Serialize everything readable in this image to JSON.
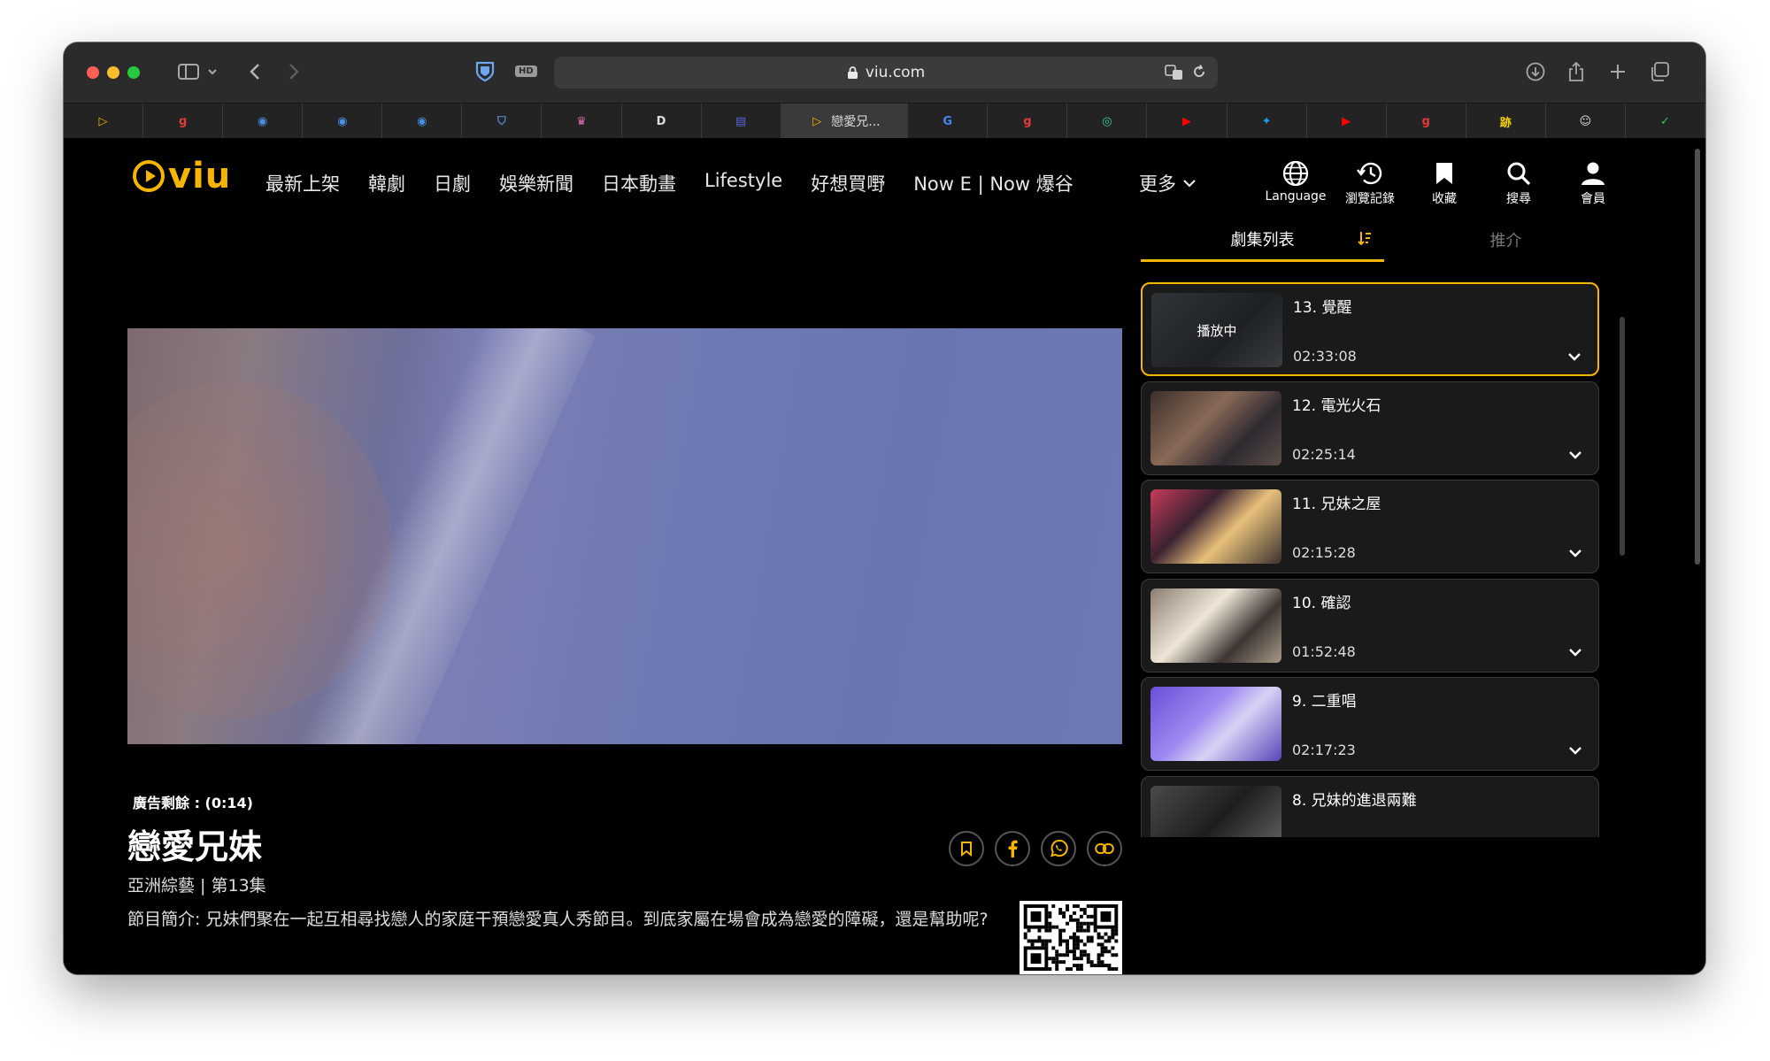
{
  "browser": {
    "url": "viu.com",
    "badge": "HD",
    "active_tab_title": "戀愛兄...",
    "tabs": [
      {
        "icon": "viu-play-icon",
        "color": "#f6b500",
        "glyph": "▷"
      },
      {
        "icon": "g-icon",
        "color": "#e23b3b",
        "glyph": "g"
      },
      {
        "icon": "globe-icon",
        "color": "#4a90e2",
        "glyph": "◉"
      },
      {
        "icon": "globe-icon",
        "color": "#4a90e2",
        "glyph": "◉"
      },
      {
        "icon": "globe-icon",
        "color": "#4a90e2",
        "glyph": "◉"
      },
      {
        "icon": "bitwarden-icon",
        "color": "#5c8fd6",
        "glyph": "⛉"
      },
      {
        "icon": "trophy-icon",
        "color": "#e06bb0",
        "glyph": "♛"
      },
      {
        "icon": "d-icon",
        "color": "#dddddd",
        "glyph": "D"
      },
      {
        "icon": "stack-icon",
        "color": "#5a63d8",
        "glyph": "▤"
      },
      {
        "icon": "viu-play-icon",
        "color": "#f6b500",
        "glyph": "▷"
      },
      {
        "icon": "google-icon",
        "color": "#4285f4",
        "glyph": "G"
      },
      {
        "icon": "g-icon",
        "color": "#e23b3b",
        "glyph": "g"
      },
      {
        "icon": "chat-icon",
        "color": "#3ccf9c",
        "glyph": "◎"
      },
      {
        "icon": "youtube-icon",
        "color": "#ff0000",
        "glyph": "▶"
      },
      {
        "icon": "twitter-icon",
        "color": "#1d9bf0",
        "glyph": "✦"
      },
      {
        "icon": "youtube-icon",
        "color": "#ff0000",
        "glyph": "▶"
      },
      {
        "icon": "g-icon",
        "color": "#e23b3b",
        "glyph": "g"
      },
      {
        "icon": "ey-icon",
        "color": "#f5d000",
        "glyph": "跡"
      },
      {
        "icon": "smile-icon",
        "color": "#dddddd",
        "glyph": "☺"
      },
      {
        "icon": "shield-check-icon",
        "color": "#34c759",
        "glyph": "✓"
      }
    ]
  },
  "site": {
    "logo": "viu",
    "nav": [
      "最新上架",
      "韓劇",
      "日劇",
      "娛樂新聞",
      "日本動畫",
      "Lifestyle",
      "好想買嘢",
      "Now E | Now 爆谷"
    ],
    "more": "更多",
    "tools": [
      {
        "label": "Language",
        "icon": "globe-icon"
      },
      {
        "label": "瀏覽記錄",
        "icon": "history-icon"
      },
      {
        "label": "收藏",
        "icon": "bookmark-icon"
      },
      {
        "label": "搜尋",
        "icon": "search-icon"
      },
      {
        "label": "會員",
        "icon": "user-icon"
      }
    ]
  },
  "player": {
    "ad_remaining": "廣告剩餘 : (0:14)"
  },
  "show": {
    "title": "戀愛兄妹",
    "meta": "亞洲綜藝 | 第13集",
    "description": "節目簡介: 兄妹們聚在一起互相尋找戀人的家庭干預戀愛真人秀節目。到底家屬在場會成為戀愛的障礙，還是幫助呢?"
  },
  "episode_panel": {
    "tab_episodes": "劇集列表",
    "tab_recommend": "推介",
    "now_playing": "播放中",
    "episodes": [
      {
        "title": "13. 覺醒",
        "duration": "02:33:08",
        "active": true
      },
      {
        "title": "12. 電光火石",
        "duration": "02:25:14",
        "active": false
      },
      {
        "title": "11. 兄妹之屋",
        "duration": "02:15:28",
        "active": false
      },
      {
        "title": "10. 確認",
        "duration": "01:52:48",
        "active": false
      },
      {
        "title": "9. 二重唱",
        "duration": "02:17:23",
        "active": false
      },
      {
        "title": "8. 兄妹的進退兩難",
        "duration": "",
        "active": false
      }
    ]
  },
  "colors": {
    "accent": "#f6b500",
    "background": "#000000",
    "card": "#1a1a1a"
  }
}
